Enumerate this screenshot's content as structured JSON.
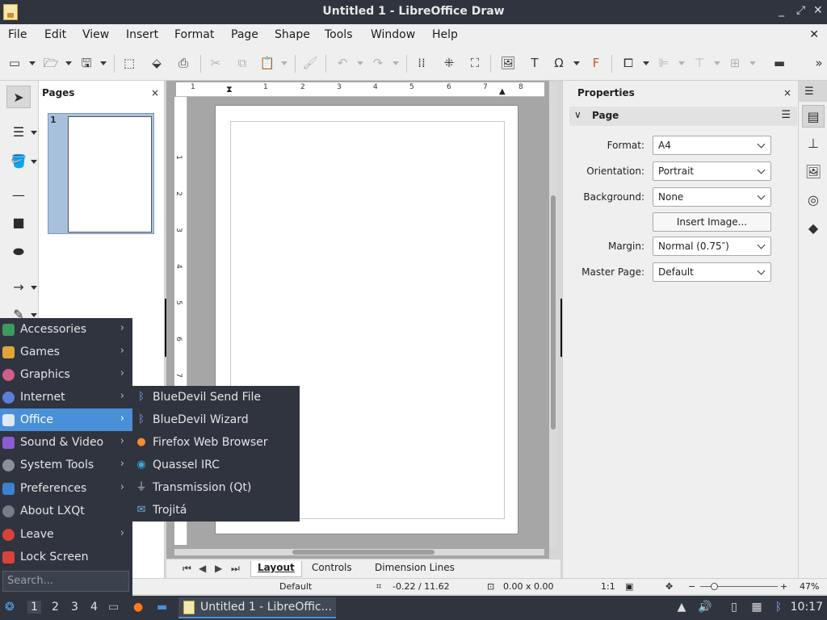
{
  "window": {
    "title": "Untitled 1 - LibreOffice Draw",
    "controls": [
      "_",
      "⤢",
      "✕"
    ]
  },
  "menubar": {
    "items": [
      "File",
      "Edit",
      "View",
      "Insert",
      "Format",
      "Page",
      "Shape",
      "Tools",
      "Window",
      "Help"
    ],
    "close": "✕"
  },
  "pages_pane": {
    "title": "Pages",
    "close": "×",
    "thumbnail_number": "1"
  },
  "ruler": {
    "h_ticks": [
      "1",
      "1",
      "2",
      "3",
      "4",
      "5",
      "6",
      "7",
      "8"
    ],
    "v_ticks": [
      "1",
      "2",
      "3",
      "4",
      "5",
      "6",
      "7"
    ]
  },
  "properties": {
    "title": "Properties",
    "close": "×",
    "section": "Page",
    "fields": {
      "format": {
        "label": "Format:",
        "value": "A4"
      },
      "orientation": {
        "label": "Orientation:",
        "value": "Portrait"
      },
      "background": {
        "label": "Background:",
        "value": "None"
      },
      "insert_image": "Insert Image...",
      "margin": {
        "label": "Margin:",
        "value": "Normal (0.75″)"
      },
      "master_page": {
        "label": "Master Page:",
        "value": "Default"
      }
    }
  },
  "tabs": {
    "items": [
      "Layout",
      "Controls",
      "Dimension Lines"
    ],
    "active": "Layout"
  },
  "statusbar": {
    "master": "Default",
    "position": "-0.22 / 11.62",
    "size": "0.00 x 0.00",
    "scale": "1:1",
    "zoom": "47%",
    "zoom_minus": "−",
    "zoom_plus": "+"
  },
  "start_menu": {
    "items": [
      {
        "label": "Accessories",
        "submenu": true,
        "color": "#3c9a5c"
      },
      {
        "label": "Games",
        "submenu": true,
        "color": "#e0a437"
      },
      {
        "label": "Graphics",
        "submenu": true,
        "color": "#d05d8a"
      },
      {
        "label": "Internet",
        "submenu": true,
        "color": "#5b7fd8"
      },
      {
        "label": "Office",
        "submenu": true,
        "color": "#4a90d9",
        "active": true
      },
      {
        "label": "Sound & Video",
        "submenu": true,
        "color": "#8b5bd6"
      },
      {
        "label": "System Tools",
        "submenu": true,
        "color": "#8a8f99"
      },
      {
        "label": "Preferences",
        "submenu": true,
        "color": "#3a82d0"
      },
      {
        "label": "About LXQt",
        "submenu": false,
        "color": "#777d88"
      },
      {
        "label": "Leave",
        "submenu": true,
        "color": "#d9423a"
      },
      {
        "label": "Lock Screen",
        "submenu": false,
        "color": "#d9423a"
      }
    ],
    "search_placeholder": "Search..."
  },
  "office_submenu": {
    "items": [
      {
        "label": "BlueDevil Send File",
        "icon": "bluetooth-icon"
      },
      {
        "label": "BlueDevil Wizard",
        "icon": "bluetooth-icon"
      },
      {
        "label": "Firefox Web Browser",
        "icon": "firefox-icon"
      },
      {
        "label": "Quassel IRC",
        "icon": "quassel-icon"
      },
      {
        "label": "Transmission (Qt)",
        "icon": "transmission-icon"
      },
      {
        "label": "Trojitá",
        "icon": "mail-icon"
      }
    ]
  },
  "taskbar": {
    "desktops": [
      "1",
      "2",
      "3",
      "4"
    ],
    "active_desktop": "1",
    "window_label": "Untitled 1 - LibreOffic...",
    "clock": "10:17"
  }
}
